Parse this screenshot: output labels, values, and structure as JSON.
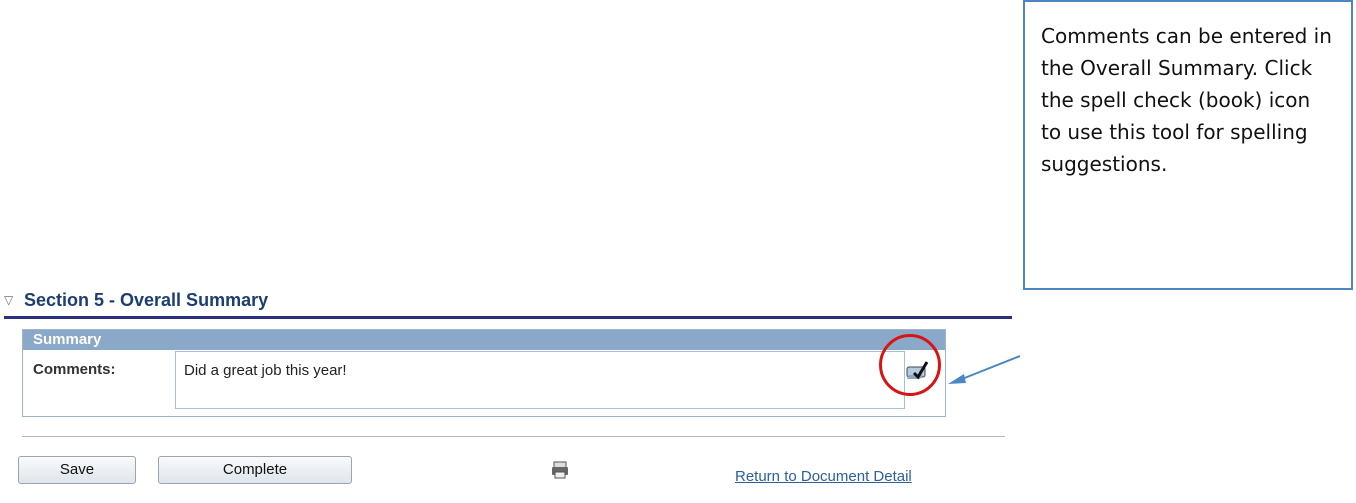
{
  "section": {
    "title": "Section 5 - Overall Summary",
    "toggle_icon": "triangle-down"
  },
  "summary": {
    "bar_title": "Summary",
    "comments_label": "Comments:",
    "comments_value": "Did a great job this year!"
  },
  "callout": {
    "text": "Comments can be entered in the Overall Summary.  Click the spell check (book) icon to use this tool for spelling suggestions."
  },
  "buttons": {
    "save": "Save",
    "complete": "Complete"
  },
  "links": {
    "return": "Return to Document Detail"
  },
  "icons": {
    "spell_check": "spell-check-icon",
    "print": "print-icon"
  }
}
